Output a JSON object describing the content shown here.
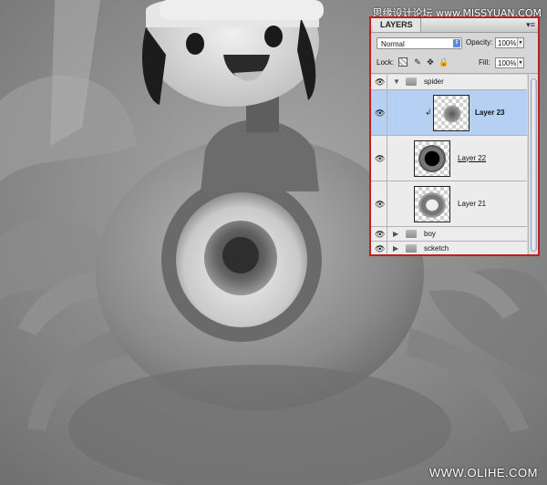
{
  "watermark_top": "思缘设计论坛 www.MISSYUAN.COM",
  "watermark_bottom": "WWW.OLIHE.COM",
  "layers_panel": {
    "tab_label": "LAYERS",
    "blend_mode": "Normal",
    "opacity_label": "Opacity:",
    "opacity_value": "100%",
    "lock_label": "Lock:",
    "fill_label": "Fill:",
    "fill_value": "100%",
    "layers": [
      {
        "name": "spider",
        "kind": "group",
        "expanded": true
      },
      {
        "name": "Layer 23",
        "kind": "layer",
        "selected": true,
        "clipped": true
      },
      {
        "name": "Layer 22",
        "kind": "layer"
      },
      {
        "name": "Layer 21",
        "kind": "layer"
      },
      {
        "name": "boy",
        "kind": "group",
        "expanded": false
      },
      {
        "name": "scketch",
        "kind": "group",
        "expanded": false
      }
    ]
  },
  "icons": {
    "eye": "eye-icon",
    "folder": "folder-icon",
    "lock_transparent": "lock-transparent-pixels-icon",
    "lock_image": "brush-icon",
    "lock_position": "move-icon",
    "lock_all": "lock-icon",
    "panel_menu": "panel-menu-icon"
  },
  "colors": {
    "panel_border": "#c21d1d",
    "selected_row": "#b5d0f2"
  }
}
